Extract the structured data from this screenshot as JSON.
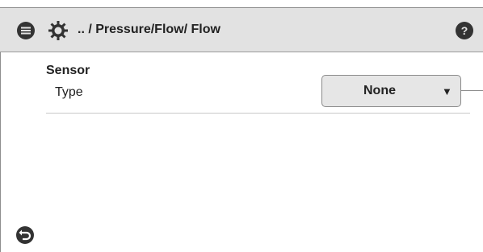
{
  "header": {
    "breadcrumb": ".. / Pressure/Flow/ Flow",
    "menu_icon": "menu-icon",
    "settings_icon": "gear-icon",
    "help_icon": "help-icon"
  },
  "section": {
    "title": "Sensor",
    "rows": [
      {
        "label": "Type",
        "value": "None",
        "control": "dropdown"
      }
    ]
  },
  "footer": {
    "back_icon": "back-icon"
  },
  "colors": {
    "header_bg": "#e2e2e2",
    "dropdown_bg": "#e6e6e6",
    "icon_dark": "#333333"
  }
}
